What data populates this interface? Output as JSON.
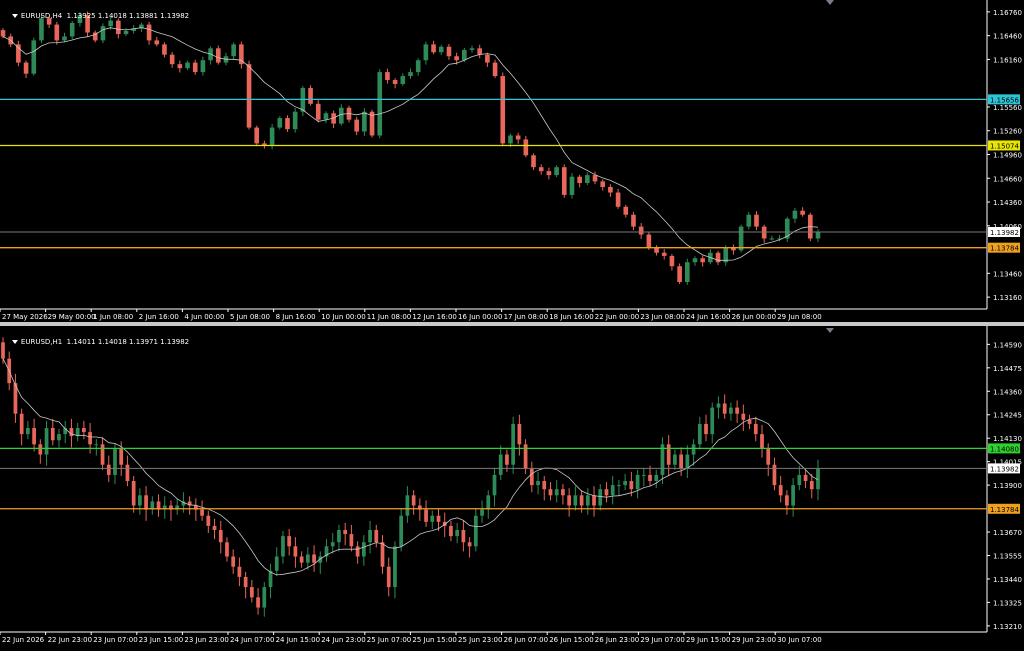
{
  "colors": {
    "background": "#000000",
    "axis": "#ffffff",
    "bull": "#2e8b57",
    "bear": "#e8675a",
    "ma": "#c8c8c8",
    "current": "#7a7a7a"
  },
  "top": {
    "title": "EURUSD,H4  1.13925 1.14018 1.13881 1.13982",
    "price_labels": [
      "1.16760",
      "1.16460",
      "1.16160",
      "1.15560",
      "1.15260",
      "1.14960",
      "1.14660",
      "1.14360",
      "1.14060",
      "1.13460",
      "1.13160"
    ],
    "time_labels": [
      "27 May 2026",
      "29 May 00:00",
      "1 Jun 08:00",
      "2 Jun 16:00",
      "4 Jun 00:00",
      "5 Jun 08:00",
      "8 Jun 16:00",
      "10 Jun 00:00",
      "11 Jun 08:00",
      "12 Jun 16:00",
      "16 Jun 00:00",
      "17 Jun 08:00",
      "18 Jun 16:00",
      "22 Jun 00:00",
      "23 Jun 08:00",
      "24 Jun 16:00",
      "26 Jun 00:00",
      "29 Jun 08:00"
    ],
    "levels": [
      {
        "price": "1.15656",
        "color": "#2ec4d6"
      },
      {
        "price": "1.15074",
        "color": "#e6e600"
      },
      {
        "price": "1.13784",
        "color": "#f0a020"
      }
    ],
    "current_price": "1.13982",
    "chart_data": {
      "type": "candlestick",
      "symbol": "EURUSD",
      "timeframe": "H4",
      "title": "EURUSD,H4  1.13925 1.14018 1.13881 1.13982",
      "ylim": [
        1.1301,
        1.1691
      ],
      "close_series": [
        1.1645,
        1.1635,
        1.1612,
        1.1598,
        1.164,
        1.1668,
        1.166,
        1.164,
        1.1645,
        1.1662,
        1.1672,
        1.165,
        1.164,
        1.1658,
        1.1665,
        1.1648,
        1.1652,
        1.1655,
        1.166,
        1.164,
        1.1635,
        1.1622,
        1.161,
        1.1605,
        1.1612,
        1.16,
        1.1615,
        1.163,
        1.1612,
        1.162,
        1.1635,
        1.161,
        1.153,
        1.151,
        1.1508,
        1.153,
        1.1542,
        1.1528,
        1.155,
        1.158,
        1.156,
        1.154,
        1.1548,
        1.1535,
        1.1555,
        1.154,
        1.1525,
        1.155,
        1.152,
        1.16,
        1.159,
        1.1585,
        1.1595,
        1.16,
        1.1615,
        1.1635,
        1.1625,
        1.1632,
        1.162,
        1.1615,
        1.1628,
        1.163,
        1.1622,
        1.1612,
        1.1595,
        1.151,
        1.152,
        1.1515,
        1.1495,
        1.148,
        1.1475,
        1.147,
        1.148,
        1.1445,
        1.1468,
        1.146,
        1.147,
        1.1462,
        1.1455,
        1.1448,
        1.143,
        1.142,
        1.1405,
        1.1395,
        1.1378,
        1.1372,
        1.1368,
        1.1355,
        1.1335,
        1.136,
        1.1365,
        1.136,
        1.1372,
        1.136,
        1.1378,
        1.1375,
        1.1405,
        1.142,
        1.1405,
        1.139,
        1.139,
        1.139,
        1.1415,
        1.1425,
        1.142,
        1.139,
        1.1398
      ],
      "moving_average": {
        "visible": true,
        "color": "#c8c8c8"
      },
      "horizontal_levels": [
        1.15656,
        1.15074,
        1.13784
      ],
      "current": 1.13982,
      "grid": false
    }
  },
  "bottom": {
    "title": "EURUSD,H1  1.14011 1.14018 1.13971 1.13982",
    "price_labels": [
      "1.14590",
      "1.14475",
      "1.14360",
      "1.14245",
      "1.14130",
      "1.14015",
      "1.13900",
      "1.13670",
      "1.13555",
      "1.13440",
      "1.13325",
      "1.13210"
    ],
    "time_labels": [
      "22 Jun 2026",
      "22 Jun 23:00",
      "23 Jun 07:00",
      "23 Jun 15:00",
      "23 Jun 23:00",
      "24 Jun 07:00",
      "24 Jun 15:00",
      "24 Jun 23:00",
      "25 Jun 07:00",
      "25 Jun 15:00",
      "25 Jun 23:00",
      "26 Jun 07:00",
      "26 Jun 15:00",
      "26 Jun 23:00",
      "29 Jun 07:00",
      "29 Jun 15:00",
      "29 Jun 23:00",
      "30 Jun 07:00"
    ],
    "levels": [
      {
        "price": "1.14080",
        "color": "#30d030"
      },
      {
        "price": "1.13784",
        "color": "#f0a020"
      }
    ],
    "current_price": "1.13982",
    "chart_data": {
      "type": "candlestick",
      "symbol": "EURUSD",
      "timeframe": "H1",
      "title": "EURUSD,H1  1.14011 1.14018 1.13971 1.13982",
      "ylim": [
        1.1318,
        1.1468
      ],
      "close_series": [
        1.1452,
        1.144,
        1.1425,
        1.1415,
        1.1418,
        1.141,
        1.1405,
        1.1418,
        1.1412,
        1.1415,
        1.1418,
        1.1414,
        1.1418,
        1.1416,
        1.141,
        1.141,
        1.14,
        1.1395,
        1.1408,
        1.14,
        1.1392,
        1.138,
        1.1385,
        1.1378,
        1.1382,
        1.1378,
        1.138,
        1.1378,
        1.138,
        1.1382,
        1.138,
        1.1378,
        1.1375,
        1.137,
        1.1368,
        1.1362,
        1.1355,
        1.135,
        1.1345,
        1.134,
        1.1335,
        1.133,
        1.134,
        1.1348,
        1.1355,
        1.1365,
        1.136,
        1.1355,
        1.1352,
        1.1356,
        1.1352,
        1.1355,
        1.136,
        1.1362,
        1.1368,
        1.1366,
        1.136,
        1.1355,
        1.1362,
        1.1368,
        1.1362,
        1.135,
        1.134,
        1.136,
        1.1375,
        1.1385,
        1.138,
        1.1378,
        1.1372,
        1.1375,
        1.1372,
        1.137,
        1.1365,
        1.1368,
        1.1362,
        1.136,
        1.1375,
        1.1378,
        1.1385,
        1.1395,
        1.1405,
        1.14,
        1.142,
        1.141,
        1.1398,
        1.139,
        1.1392,
        1.1388,
        1.1385,
        1.1388,
        1.1385,
        1.138,
        1.1385,
        1.138,
        1.1385,
        1.138,
        1.1388,
        1.1385,
        1.139,
        1.139,
        1.1392,
        1.1388,
        1.1395,
        1.1395,
        1.1392,
        1.1395,
        1.141,
        1.14,
        1.1405,
        1.1398,
        1.1405,
        1.141,
        1.142,
        1.1415,
        1.1428,
        1.143,
        1.1425,
        1.1428,
        1.1425,
        1.1422,
        1.142,
        1.1415,
        1.1408,
        1.14,
        1.139,
        1.1385,
        1.138,
        1.139,
        1.1395,
        1.1392,
        1.1388,
        1.1398
      ],
      "moving_average": {
        "visible": true,
        "color": "#c8c8c8"
      },
      "horizontal_levels": [
        1.1408,
        1.13784
      ],
      "current": 1.13982,
      "grid": false
    }
  }
}
